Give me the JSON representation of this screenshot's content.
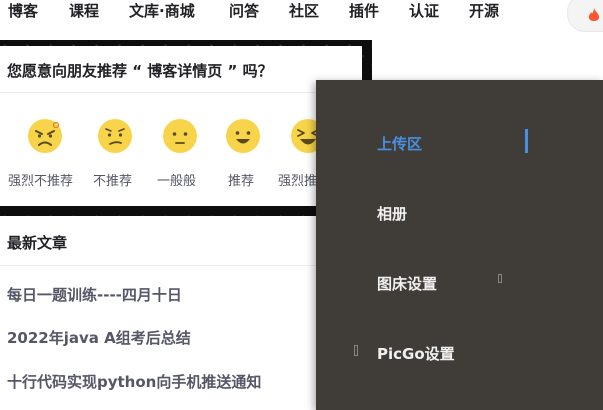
{
  "nav": {
    "items": [
      "博客",
      "课程",
      "文库·商城",
      "问答",
      "社区",
      "插件",
      "认证",
      "开源"
    ]
  },
  "recommend": {
    "question": "您愿意向朋友推荐 “ 博客详情页 ” 吗？",
    "options": [
      {
        "label": "强烈不推荐",
        "icon": "angry-face-icon"
      },
      {
        "label": "不推荐",
        "icon": "worried-face-icon"
      },
      {
        "label": "一般般",
        "icon": "neutral-face-icon"
      },
      {
        "label": "推荐",
        "icon": "smiling-face-icon"
      },
      {
        "label": "强烈推荐",
        "icon": "laughing-face-icon"
      }
    ]
  },
  "articles": {
    "heading": "最新文章",
    "items": [
      "每日一题训练----四月十日",
      "2022年java A组考后总结",
      "十行代码实现python向手机推送通知"
    ]
  },
  "menu": {
    "items": [
      {
        "label": "上传区",
        "active": true
      },
      {
        "label": "相册",
        "active": false
      },
      {
        "label": "图床设置",
        "active": false
      },
      {
        "label": "PicGo设置",
        "active": false
      }
    ]
  },
  "colors": {
    "accent": "#4a90e2",
    "menu_bg": "#403c38",
    "emoji": "#f7d44a",
    "hot": "#fc5531"
  }
}
